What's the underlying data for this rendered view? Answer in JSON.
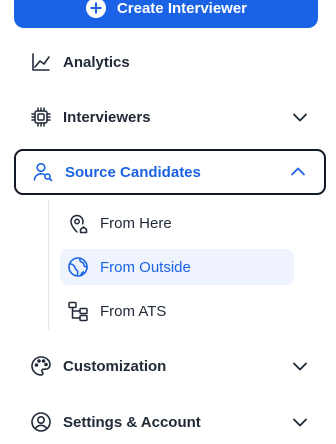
{
  "create_button": {
    "label": "Create Interviewer",
    "icon": "plus-circle-icon"
  },
  "nav": [
    {
      "id": "analytics",
      "label": "Analytics",
      "icon": "line-chart-icon",
      "expandable": false
    },
    {
      "id": "interviewers",
      "label": "Interviewers",
      "icon": "chip-icon",
      "expandable": true,
      "expanded": false
    },
    {
      "id": "source-candidates",
      "label": "Source Candidates",
      "icon": "user-search-icon",
      "expandable": true,
      "expanded": true,
      "active": true
    },
    {
      "id": "customization",
      "label": "Customization",
      "icon": "palette-icon",
      "expandable": true,
      "expanded": false
    },
    {
      "id": "settings-account",
      "label": "Settings & Account",
      "icon": "user-circle-icon",
      "expandable": true,
      "expanded": false
    }
  ],
  "subnav": [
    {
      "label": "From Here",
      "icon": "map-pin-home-icon",
      "selected": false
    },
    {
      "label": "From Outside",
      "icon": "globe-icon",
      "selected": true
    },
    {
      "label": "From ATS",
      "icon": "hierarchy-icon",
      "selected": false
    }
  ],
  "colors": {
    "accent": "#1b63e6",
    "selected_bg": "#eef3fd",
    "text": "#1f2937",
    "active_border": "#111827"
  }
}
